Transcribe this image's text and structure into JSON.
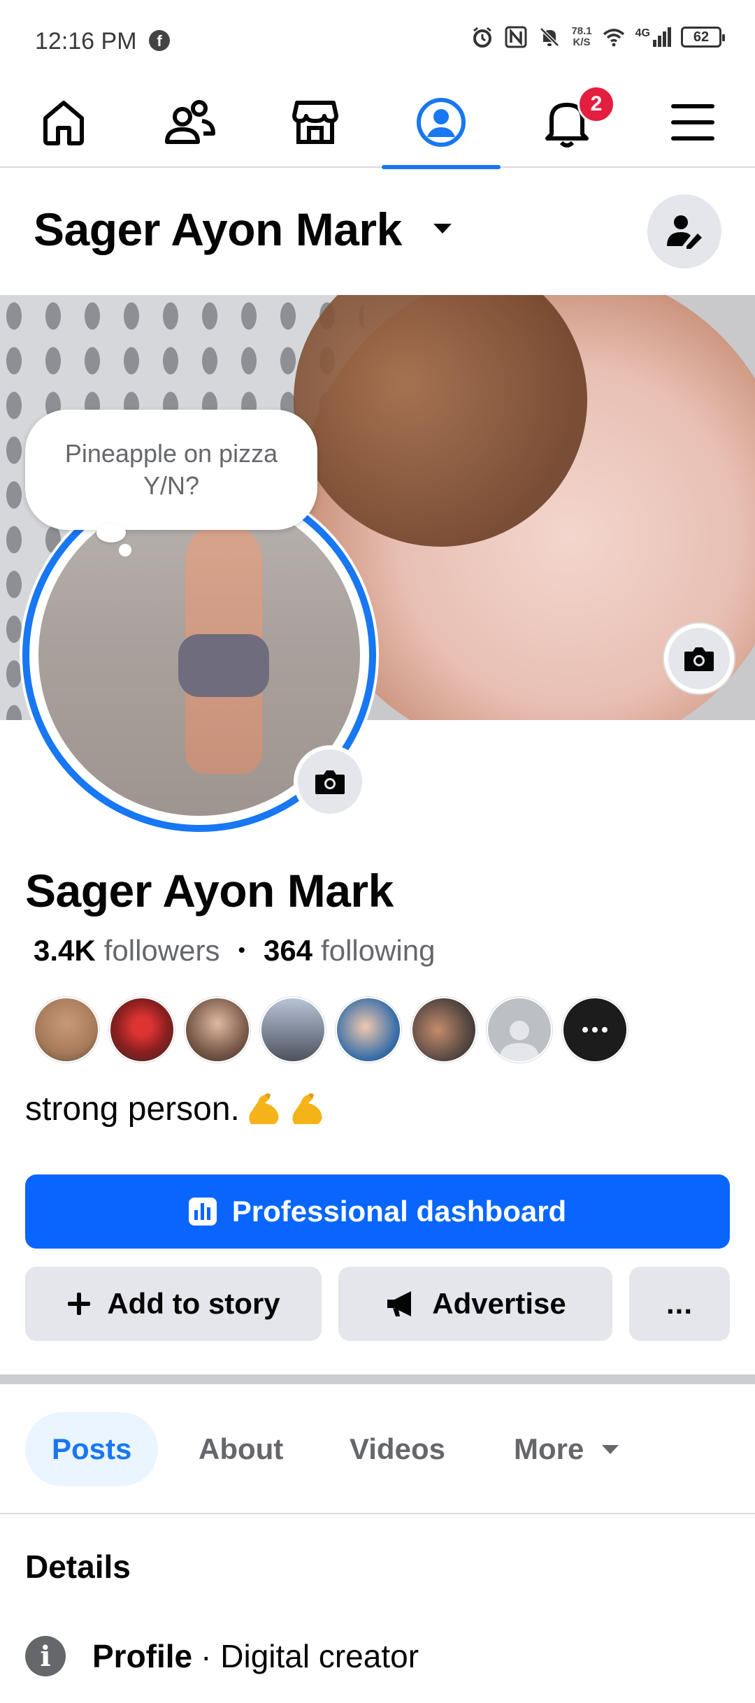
{
  "status_bar": {
    "time": "12:16 PM",
    "network_speed_value": "78.1",
    "network_speed_unit": "K/S",
    "network_type": "4G",
    "battery": "62"
  },
  "top_nav": {
    "items": [
      {
        "icon": "home-icon"
      },
      {
        "icon": "friends-icon"
      },
      {
        "icon": "marketplace-icon"
      },
      {
        "icon": "profile-icon",
        "active": true
      },
      {
        "icon": "notifications-icon",
        "badge": "2"
      },
      {
        "icon": "menu-icon"
      }
    ],
    "notification_badge": "2"
  },
  "header": {
    "name": "Sager Ayon Mark"
  },
  "note": {
    "text": "Pineapple on pizza Y/N?"
  },
  "profile": {
    "name": "Sager Ayon Mark",
    "followers_count": "3.4K",
    "followers_label": "followers",
    "following_count": "364",
    "following_label": "following",
    "bio": "strong person.",
    "bio_emoji": "flexed-biceps x2"
  },
  "friends_preview": [
    {
      "color": "#a77b5a"
    },
    {
      "color": "#8a1f1f"
    },
    {
      "color": "#7a5a4a"
    },
    {
      "color": "#7d8696"
    },
    {
      "color": "#3a6fa8"
    },
    {
      "color": "#5b4b44"
    },
    {
      "color": "#bcc0c4",
      "placeholder": true
    },
    {
      "color": "#1c1c1c",
      "more": true
    }
  ],
  "actions": {
    "professional_dashboard": "Professional dashboard",
    "add_to_story": "Add to story",
    "advertise": "Advertise",
    "more": "..."
  },
  "tabs": [
    {
      "label": "Posts",
      "active": true
    },
    {
      "label": "About"
    },
    {
      "label": "Videos"
    },
    {
      "label": "More"
    }
  ],
  "details": {
    "title": "Details",
    "profile_label": "Profile",
    "profile_value": "· Digital creator"
  },
  "colors": {
    "accent": "#1877f2",
    "primary_button": "#0866ff",
    "badge": "#e41e3f",
    "secondary_button": "#e4e6eb",
    "text_secondary": "#65676b"
  }
}
